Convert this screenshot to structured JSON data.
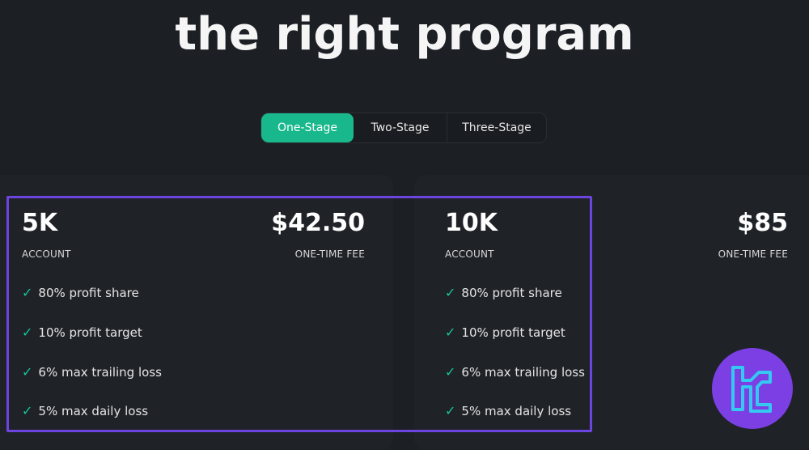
{
  "header": {
    "title": "the right program"
  },
  "tabs": [
    {
      "label": "One-Stage",
      "active": true
    },
    {
      "label": "Two-Stage",
      "active": false
    },
    {
      "label": "Three-Stage",
      "active": false
    }
  ],
  "plans": [
    {
      "size": "5K",
      "size_caption": "ACCOUNT",
      "price": "$42.50",
      "price_caption": "ONE-TIME FEE",
      "features": [
        "80% profit share",
        "10% profit target",
        "6% max trailing loss",
        "5% max daily loss"
      ]
    },
    {
      "size": "10K",
      "size_caption": "ACCOUNT",
      "price": "$85",
      "price_caption": "ONE-TIME FEE",
      "features": [
        "80% profit share",
        "10% profit target",
        "6% max trailing loss",
        "5% max daily loss"
      ]
    }
  ],
  "colors": {
    "accent": "#18b88c",
    "highlight": "#6c45e0",
    "background": "#1c1f24",
    "logo_bg": "#7b3fe4",
    "logo_stroke": "#35c8f0"
  },
  "icons": {
    "check": "✓",
    "logo": "brand-logo-icon"
  }
}
